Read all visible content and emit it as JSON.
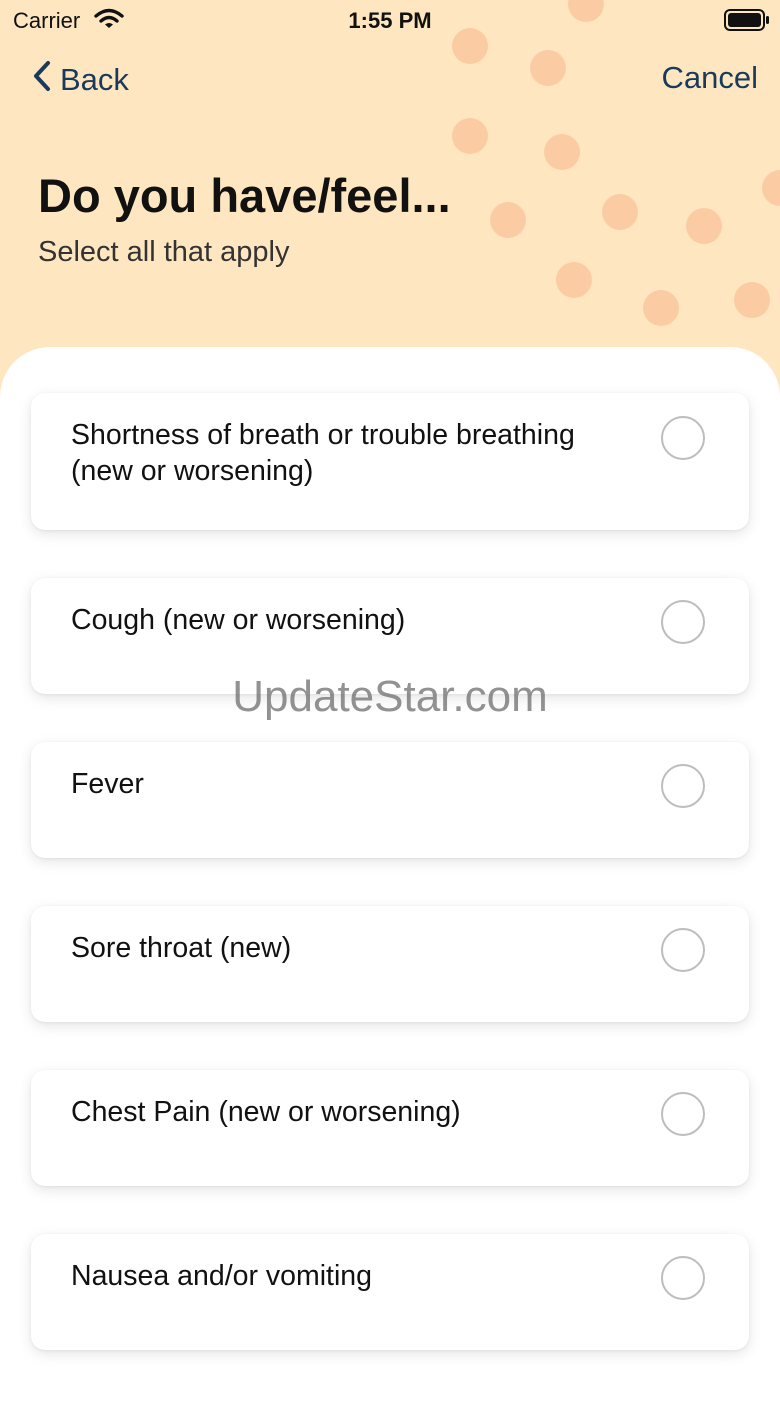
{
  "status_bar": {
    "carrier": "Carrier",
    "time": "1:55 PM"
  },
  "nav": {
    "back_label": "Back",
    "cancel_label": "Cancel"
  },
  "header": {
    "title": "Do you have/feel...",
    "subtitle": "Select all that apply"
  },
  "symptoms": [
    {
      "label": "Shortness of breath or trouble breathing (new or worsening)",
      "selected": false
    },
    {
      "label": "Cough (new or worsening)",
      "selected": false
    },
    {
      "label": "Fever",
      "selected": false
    },
    {
      "label": "Sore throat (new)",
      "selected": false
    },
    {
      "label": "Chest Pain (new or worsening)",
      "selected": false
    },
    {
      "label": "Nausea and/or vomiting",
      "selected": false
    }
  ],
  "watermark": "UpdateStar.com",
  "colors": {
    "header_bg": "#FEE7C0",
    "dots": "#FBC9A0",
    "nav_text": "#1A3A5C",
    "radio_border": "#BDBDBD"
  },
  "icons": {
    "back": "chevron-left-icon",
    "wifi": "wifi-icon",
    "battery": "battery-icon"
  }
}
